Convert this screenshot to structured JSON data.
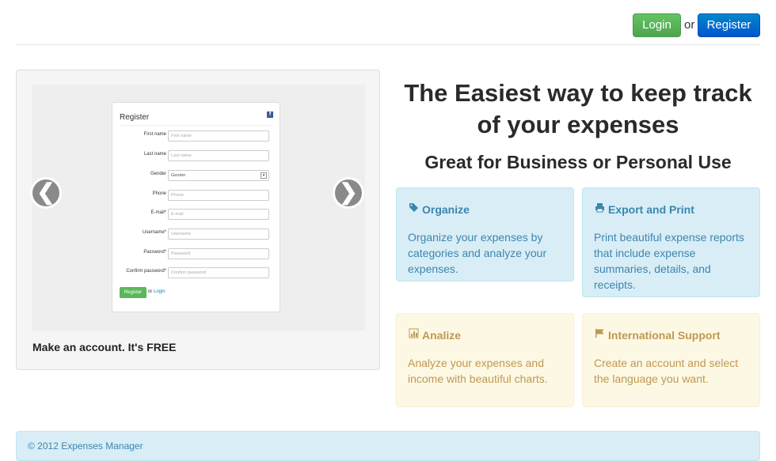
{
  "header": {
    "login_label": "Login",
    "or_text": "or",
    "register_label": "Register"
  },
  "carousel": {
    "prev_glyph": "❮",
    "next_glyph": "❯",
    "caption": "Make an account. It's FREE",
    "slide_form": {
      "title": "Register",
      "fields": [
        {
          "label": "First name",
          "placeholder": "First name"
        },
        {
          "label": "Last name",
          "placeholder": "Last name"
        },
        {
          "label": "Gender",
          "placeholder": "Gender"
        },
        {
          "label": "Phone",
          "placeholder": "Phone"
        },
        {
          "label": "E-mail*",
          "placeholder": "E-mail"
        },
        {
          "label": "Username*",
          "placeholder": "Username"
        },
        {
          "label": "Password*",
          "placeholder": "Password"
        },
        {
          "label": "Confirm password*",
          "placeholder": "Confirm password"
        }
      ],
      "button_label": "Register",
      "or_text": "or",
      "login_link": "Login"
    }
  },
  "hero": {
    "title": "The Easiest way to keep track of your expenses",
    "subtitle": "Great for Business or Personal Use"
  },
  "features": [
    {
      "icon": "tags-icon",
      "title": "Organize",
      "text": "Organize your expenses by categories and analyze your expenses."
    },
    {
      "icon": "print-icon",
      "title": "Export and Print",
      "text": "Print beautiful expense reports that include expense summaries, details, and receipts."
    },
    {
      "icon": "bar-chart-icon",
      "title": "Analize",
      "text": "Analyze your expenses and income with beautiful charts."
    },
    {
      "icon": "flag-icon",
      "title": "International Support",
      "text": "Create an account and select the language you want."
    }
  ],
  "footer": {
    "text": "© 2012 Expenses Manager"
  },
  "colors": {
    "login_green": "#51a351",
    "register_blue": "#0055cc",
    "info_bg": "#d9edf7",
    "info_text": "#3a87ad",
    "warn_bg": "#fcf8e3",
    "warn_text": "#c09853"
  }
}
